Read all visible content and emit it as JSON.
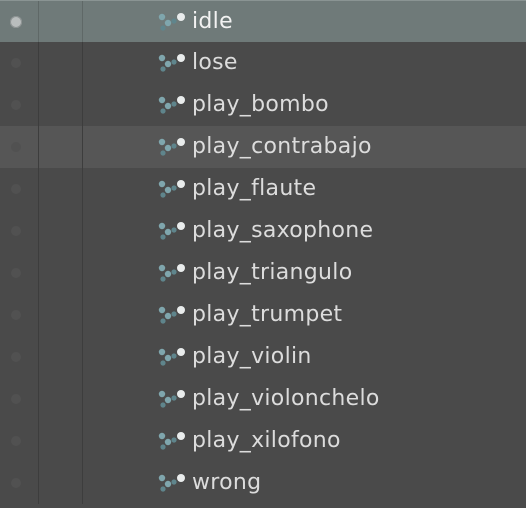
{
  "animations": {
    "items": [
      {
        "label": "idle",
        "state": "selected"
      },
      {
        "label": "lose",
        "state": "normal"
      },
      {
        "label": "play_bombo",
        "state": "normal"
      },
      {
        "label": "play_contrabajo",
        "state": "hover"
      },
      {
        "label": "play_flaute",
        "state": "normal"
      },
      {
        "label": "play_saxophone",
        "state": "normal"
      },
      {
        "label": "play_triangulo",
        "state": "normal"
      },
      {
        "label": "play_trumpet",
        "state": "normal"
      },
      {
        "label": "play_violin",
        "state": "normal"
      },
      {
        "label": "play_violonchelo",
        "state": "normal"
      },
      {
        "label": "play_xilofono",
        "state": "normal"
      },
      {
        "label": "wrong",
        "state": "normal"
      }
    ],
    "icon": "animation-clip-icon"
  },
  "colors": {
    "background": "#4a4a4a",
    "selected_row": "#6f7a79",
    "hover_row": "#565656",
    "text": "#dcdcdc",
    "icon_teal": "#7fa6ad"
  }
}
